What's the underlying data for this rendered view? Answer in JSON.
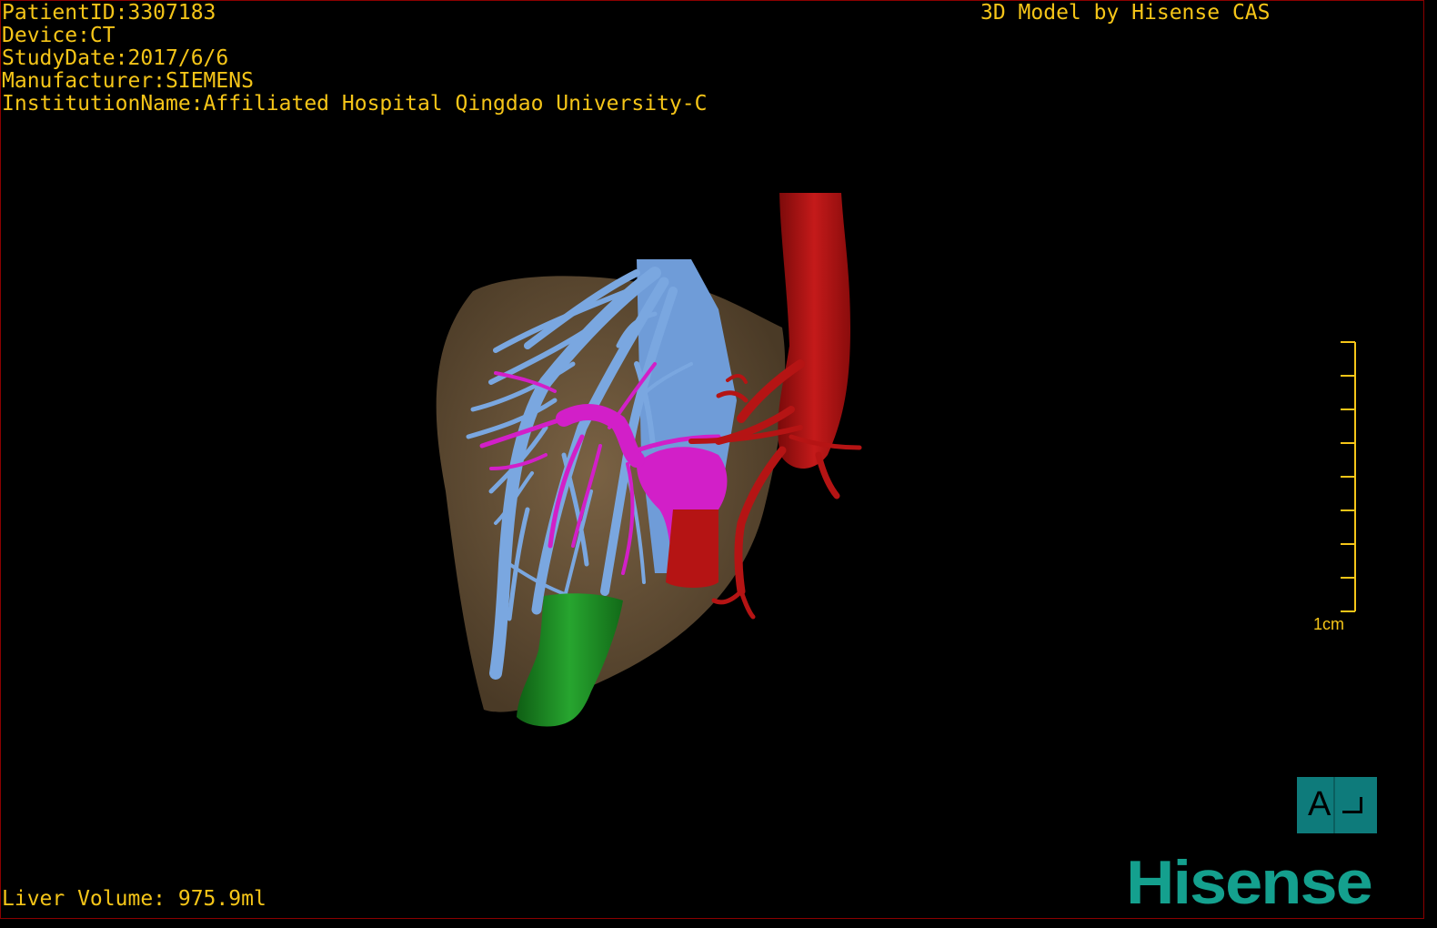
{
  "overlay": {
    "patient_id": "PatientID:3307183",
    "device": "Device:CT",
    "study_date": "StudyDate:2017/6/6",
    "manufacturer": "Manufacturer:SIEMENS",
    "institution": "InstitutionName:Affiliated Hospital Qingdao University-C",
    "model_credit": "3D Model by Hisense CAS",
    "liver_volume": "Liver Volume: 975.9ml"
  },
  "scale_bar": {
    "label": "1cm"
  },
  "orientation_cube": {
    "letter": "A"
  },
  "logo": {
    "text": "Hisense"
  },
  "colors": {
    "overlay_text": "#f5c518",
    "liver": "#6b5538",
    "hepatic_veins": "#7aa7e0",
    "portal_vein": "#d21fc8",
    "arteries": "#b51414",
    "gallbladder": "#1f8a26",
    "brand": "#14a08e",
    "orientation_bg": "#0e7b7b"
  },
  "icons": [
    "orientation-cube-icon",
    "hisense-logo"
  ]
}
